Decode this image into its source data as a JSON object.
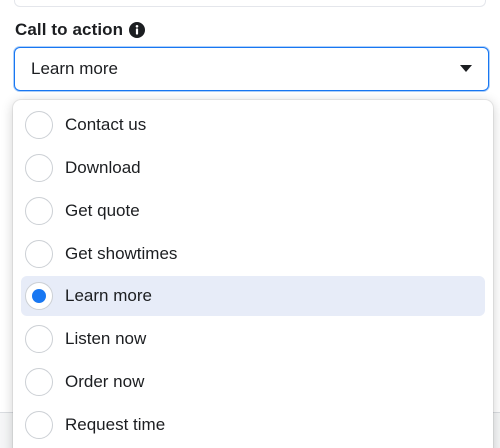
{
  "field": {
    "label": "Call to action",
    "info_icon": "info-circle-icon",
    "selected_value": "Learn more",
    "caret_icon": "caret-down-icon"
  },
  "dropdown": {
    "options": [
      {
        "label": "Contact us",
        "selected": false
      },
      {
        "label": "Download",
        "selected": false
      },
      {
        "label": "Get quote",
        "selected": false
      },
      {
        "label": "Get showtimes",
        "selected": false
      },
      {
        "label": "Learn more",
        "selected": true
      },
      {
        "label": "Listen now",
        "selected": false
      },
      {
        "label": "Order now",
        "selected": false
      },
      {
        "label": "Request time",
        "selected": false
      }
    ]
  },
  "colors": {
    "accent": "#1877f2",
    "selected_row_bg": "#e7ecf8",
    "text": "#1c1e21",
    "radio_border": "#ccd0d5"
  }
}
